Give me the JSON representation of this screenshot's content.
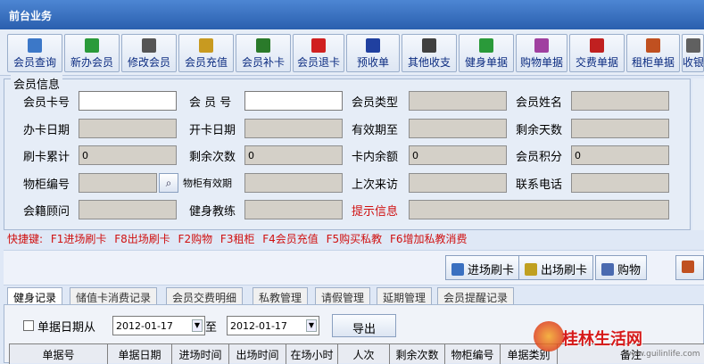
{
  "window": {
    "title": "前台业务"
  },
  "toolbar": {
    "buttons": [
      {
        "label": "会员查询",
        "icon": "search-icon",
        "color": "#3c78c8"
      },
      {
        "label": "新办会员",
        "icon": "new-member-icon",
        "color": "#2a9a3a"
      },
      {
        "label": "修改会员",
        "icon": "edit-member-icon",
        "color": "#555555"
      },
      {
        "label": "会员充值",
        "icon": "recharge-icon",
        "color": "#c89a20"
      },
      {
        "label": "会员补卡",
        "icon": "reissue-card-icon",
        "color": "#2a7a2a"
      },
      {
        "label": "会员退卡",
        "icon": "refund-card-icon",
        "color": "#d02020"
      },
      {
        "label": "预收单",
        "icon": "prepay-icon",
        "color": "#2040a0"
      },
      {
        "label": "其他收支",
        "icon": "other-income-icon",
        "color": "#404040"
      },
      {
        "label": "健身单据",
        "icon": "fitness-receipt-icon",
        "color": "#2a9a3a"
      },
      {
        "label": "购物单据",
        "icon": "shopping-receipt-icon",
        "color": "#a040a0"
      },
      {
        "label": "交费单据",
        "icon": "payment-receipt-icon",
        "color": "#c02020"
      },
      {
        "label": "租柜单据",
        "icon": "locker-receipt-icon",
        "color": "#c05020"
      },
      {
        "label": "收银",
        "icon": "cashier-icon",
        "color": "#606060"
      }
    ]
  },
  "member_info": {
    "title": "会员信息",
    "card_no_label": "会员卡号",
    "member_no_label": "会 员 号",
    "member_type_label": "会员类型",
    "member_name_label": "会员姓名",
    "open_date_label": "办卡日期",
    "start_date_label": "开卡日期",
    "valid_until_label": "有效期至",
    "days_left_label": "剩余天数",
    "swipe_total_label": "刷卡累计",
    "swipe_total_value": "0",
    "times_left_label": "剩余次数",
    "times_left_value": "0",
    "card_balance_label": "卡内余额",
    "card_balance_value": "0",
    "points_label": "会员积分",
    "points_value": "0",
    "locker_no_label": "物柜编号",
    "locker_valid_label": "物柜有效期",
    "last_visit_label": "上次来访",
    "phone_label": "联系电话",
    "advisor_label": "会籍顾问",
    "coach_label": "健身教练",
    "notice_label": "提示信息"
  },
  "shortcuts": "快捷键: F1进场刷卡 F8出场刷卡 F2购物 F3租柜 F4会员充值 F5购买私教 F6增加私教消费",
  "actions": {
    "enter": "进场刷卡",
    "exit": "出场刷卡",
    "shop": "购物",
    "more_icon": "home-icon"
  },
  "tabs": [
    "健身记录",
    "储值卡消费记录",
    "会员交费明细",
    "私教管理",
    "请假管理",
    "延期管理",
    "会员提醒记录"
  ],
  "filter": {
    "checkbox_label": "单据日期从",
    "date_from": "2012-01-17",
    "to_label": "至",
    "date_to": "2012-01-17",
    "export_label": "导出"
  },
  "grid": {
    "columns": [
      "单据号",
      "单据日期",
      "进场时间",
      "出场时间",
      "在场小时",
      "人次",
      "剩余次数",
      "物柜编号",
      "单据类别",
      "备注"
    ]
  },
  "watermark": {
    "text": "桂林生活网",
    "url": "www.guilinlife.com"
  }
}
